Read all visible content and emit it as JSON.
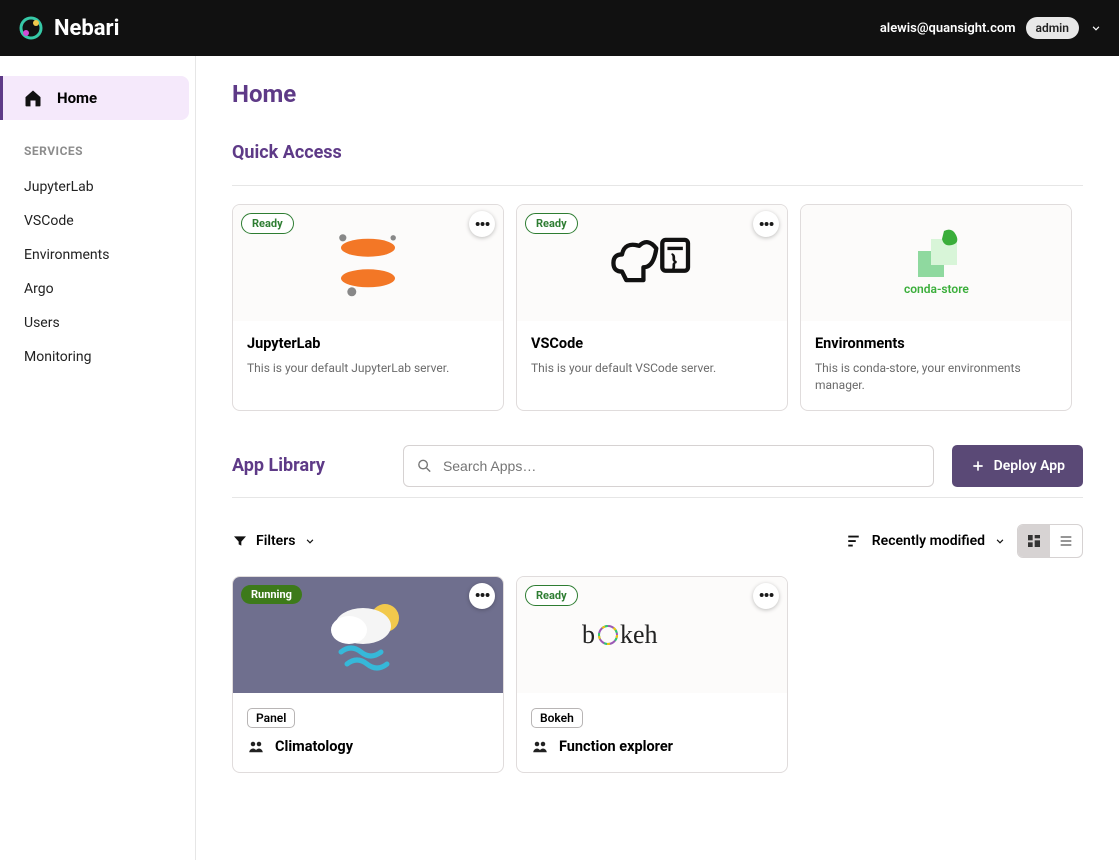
{
  "header": {
    "product": "Nebari",
    "user_email": "alewis@quansight.com",
    "role": "admin"
  },
  "sidebar": {
    "home_label": "Home",
    "section_label": "SERVICES",
    "items": [
      "JupyterLab",
      "VSCode",
      "Environments",
      "Argo",
      "Users",
      "Monitoring"
    ]
  },
  "page": {
    "title": "Home"
  },
  "quick_access": {
    "title": "Quick Access",
    "cards": [
      {
        "status": "Ready",
        "title": "JupyterLab",
        "desc": "This is your default JupyterLab server."
      },
      {
        "status": "Ready",
        "title": "VSCode",
        "desc": "This is your default VSCode server."
      },
      {
        "status": null,
        "title": "Environments",
        "desc": "This is conda-store, your environments manager."
      }
    ]
  },
  "library": {
    "title": "App Library",
    "search_placeholder": "Search Apps…",
    "deploy_label": "Deploy App",
    "filters_label": "Filters",
    "sort_label": "Recently modified",
    "apps": [
      {
        "status": "Running",
        "status_kind": "running",
        "framework": "Panel",
        "name": "Climatology"
      },
      {
        "status": "Ready",
        "status_kind": "ready",
        "framework": "Bokeh",
        "name": "Function explorer"
      }
    ]
  }
}
